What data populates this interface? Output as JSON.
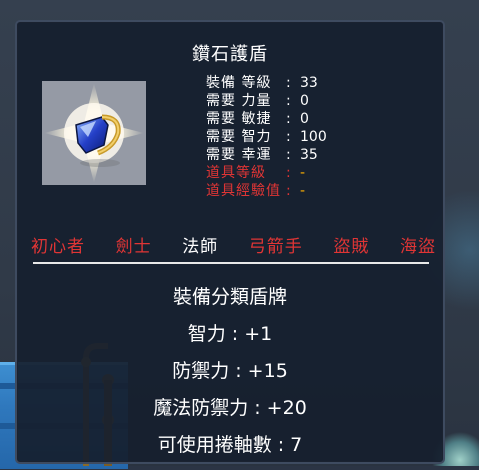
{
  "item": {
    "name": "鑽石護盾",
    "icon": "diamond-shield-icon"
  },
  "requirements": [
    {
      "label": "裝備 等級",
      "value": "33",
      "color": "#ffffff"
    },
    {
      "label": "需要 力量",
      "value": "0",
      "color": "#ffffff"
    },
    {
      "label": "需要 敏捷",
      "value": "0",
      "color": "#ffffff"
    },
    {
      "label": "需要 智力",
      "value": "100",
      "color": "#ffffff"
    },
    {
      "label": "需要 幸運",
      "value": "35",
      "color": "#ffffff"
    },
    {
      "label": "道具等級",
      "value": "-",
      "color": "#e03535"
    },
    {
      "label": "道具經驗值",
      "value": "-",
      "color": "#e03535"
    }
  ],
  "separator": ":",
  "jobs": [
    {
      "name": "初心者",
      "color": "#e03535"
    },
    {
      "name": "劍士",
      "color": "#e03535"
    },
    {
      "name": "法師",
      "color": "#ffffff"
    },
    {
      "name": "弓箭手",
      "color": "#e03535"
    },
    {
      "name": "盜賊",
      "color": "#e03535"
    },
    {
      "name": "海盜",
      "color": "#e03535"
    }
  ],
  "effects": [
    "裝備分類盾牌",
    "智力 : +1",
    "防禦力 : +15",
    "魔法防禦力 : +20",
    "可使用捲軸數 : 7"
  ]
}
